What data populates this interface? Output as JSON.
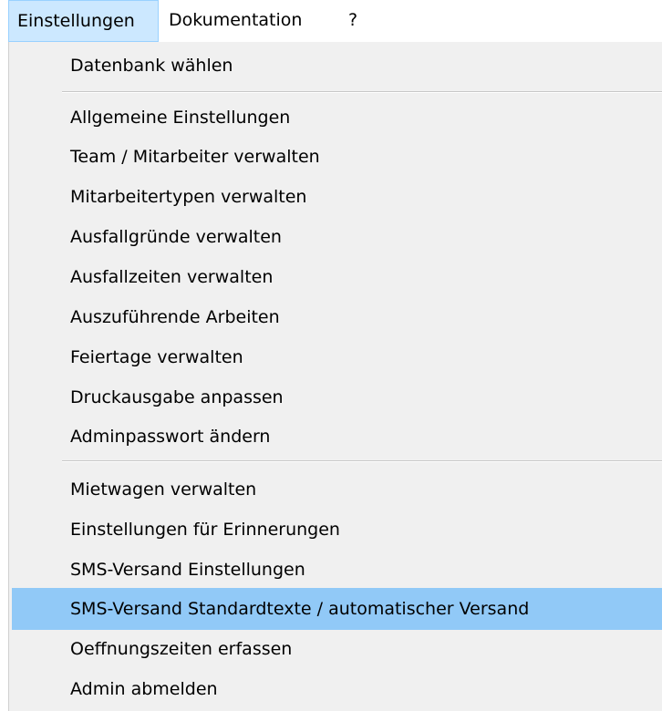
{
  "menubar": {
    "items": [
      {
        "label": "Einstellungen"
      },
      {
        "label": "Dokumentation"
      },
      {
        "label": "?"
      }
    ]
  },
  "menu": {
    "items": [
      {
        "label": "Datenbank wählen"
      },
      {
        "label": "Allgemeine Einstellungen"
      },
      {
        "label": "Team / Mitarbeiter verwalten"
      },
      {
        "label": "Mitarbeitertypen verwalten"
      },
      {
        "label": "Ausfallgründe verwalten"
      },
      {
        "label": "Ausfallzeiten verwalten"
      },
      {
        "label": "Auszuführende Arbeiten"
      },
      {
        "label": "Feiertage verwalten"
      },
      {
        "label": "Druckausgabe anpassen"
      },
      {
        "label": "Adminpasswort ändern"
      },
      {
        "label": "Mietwagen verwalten"
      },
      {
        "label": "Einstellungen für Erinnerungen"
      },
      {
        "label": "SMS-Versand Einstellungen"
      },
      {
        "label": "SMS-Versand Standardtexte / automatischer Versand"
      },
      {
        "label": "Oeffnungszeiten erfassen"
      },
      {
        "label": "Admin abmelden"
      }
    ]
  },
  "colors": {
    "menubar_active_bg": "#cce8ff",
    "menubar_active_border": "#99d1ff",
    "dropdown_bg": "#f0f0f0",
    "highlight_bg": "#91c9f7"
  }
}
